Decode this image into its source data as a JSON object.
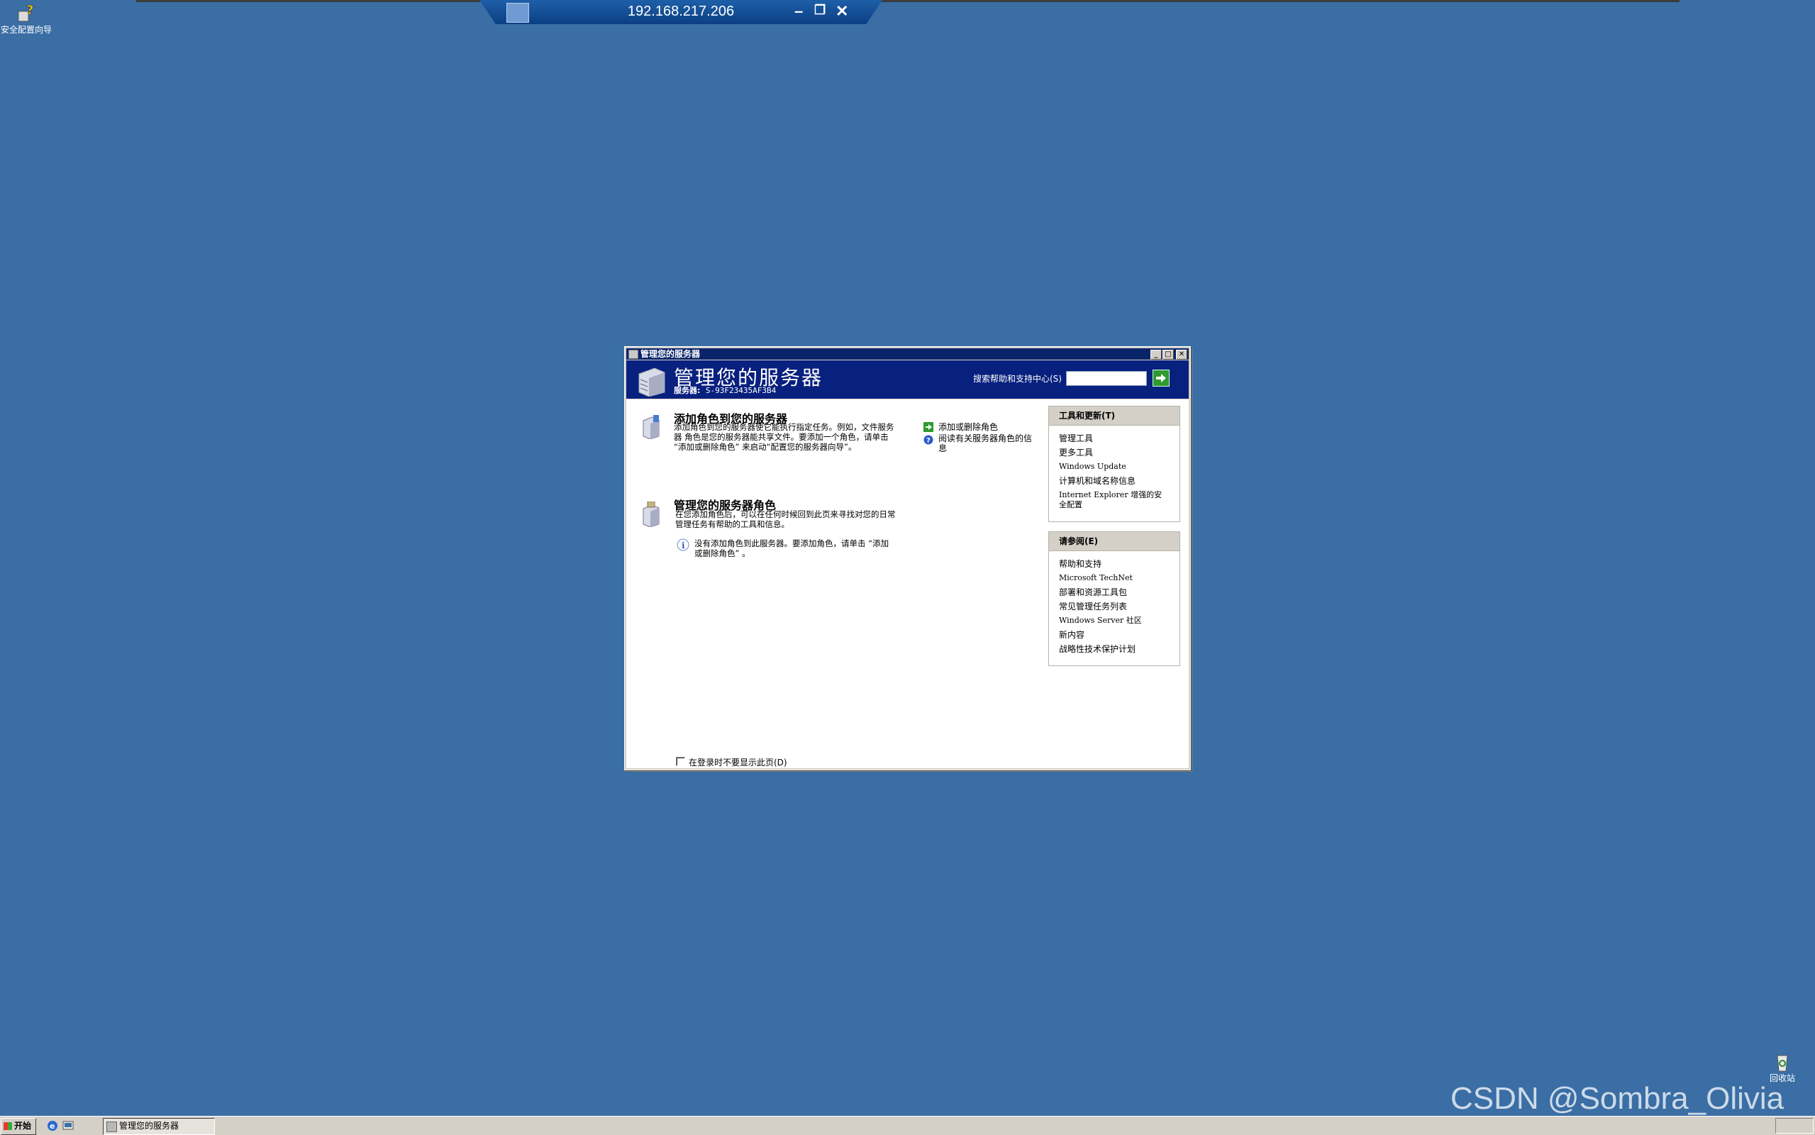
{
  "rdp": {
    "title": "192.168.217.206"
  },
  "desktop": {
    "icons": [
      {
        "label": "安全配置向导"
      },
      {
        "label": "回收站"
      }
    ]
  },
  "window": {
    "title": "管理您的服务器",
    "header": {
      "title": "管理您的服务器",
      "server_label": "服务器:",
      "server_name": "S-93F23435AF3B4",
      "search_label": "搜索帮助和支持中心(S)",
      "search_value": ""
    },
    "sections": [
      {
        "title": "添加角色到您的服务器",
        "text_lines": [
          "添加角色到您的服务器使它能执行指定任务。例如，文件服务",
          "器 角色是您的服务器能共享文件。要添加一个角色，请单击",
          "“添加或删除角色” 来启动“配置您的服务器向导”。"
        ],
        "links": [
          {
            "label": "添加或删除角色"
          },
          {
            "label": "阅读有关服务器角色的信息"
          }
        ]
      },
      {
        "title": "管理您的服务器角色",
        "text_lines": [
          "在您添加角色后，可以在任何时候回到此页来寻找对您的日常",
          "管理任务有帮助的工具和信息。"
        ],
        "info_lines": [
          "没有添加角色到此服务器。要添加角色，请单击 “添加",
          "或删除角色” 。"
        ]
      }
    ],
    "panels": [
      {
        "header": "工具和更新(T)",
        "items": [
          "管理工具",
          "更多工具",
          "Windows Update",
          "计算机和域名称信息",
          "Internet Explorer 增强的安",
          "全配置"
        ]
      },
      {
        "header": "请参阅(E)",
        "items": [
          "帮助和支持",
          "Microsoft TechNet",
          "部署和资源工具包",
          "常见管理任务列表",
          "Windows Server 社区",
          "新内容",
          "战略性技术保护计划"
        ]
      }
    ],
    "checkbox_label": "在登录时不要显示此页(D)"
  },
  "taskbar": {
    "start_label": "开始",
    "task_button": "管理您的服务器"
  },
  "watermark": "CSDN @Sombra_Olivia"
}
